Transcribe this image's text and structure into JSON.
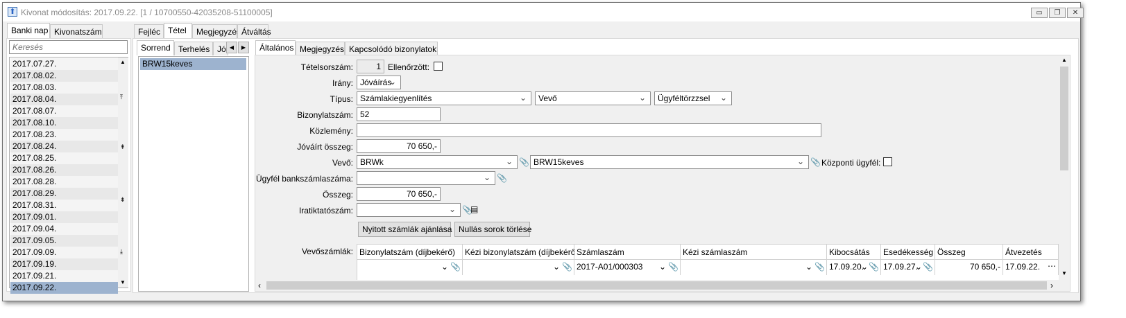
{
  "window": {
    "title": "Kivonat módosítás: 2017.09.22. [1 / 10700550-42035208-51100005]",
    "minimize": "▭",
    "restore": "❐",
    "close": "✕"
  },
  "left": {
    "tabs": [
      "Banki nap",
      "Kivonatszám"
    ],
    "search_placeholder": "Keresés",
    "dates": [
      "2017.07.27.",
      "2017.08.02.",
      "2017.08.03.",
      "2017.08.04.",
      "2017.08.07.",
      "2017.08.10.",
      "2017.08.23.",
      "2017.08.24.",
      "2017.08.25.",
      "2017.08.26.",
      "2017.08.28.",
      "2017.08.29.",
      "2017.08.31.",
      "2017.09.01.",
      "2017.09.04.",
      "2017.09.05.",
      "2017.09.09.",
      "2017.09.19.",
      "2017.09.21.",
      "2017.09.22."
    ],
    "selected": "2017.09.22."
  },
  "main_tabs": [
    "Fejléc",
    "Tétel",
    "Megjegyzés",
    "Átváltás"
  ],
  "middle": {
    "tabs": [
      "Sorrend",
      "Terhelés",
      "Jóv"
    ],
    "items": [
      "BRW15keves"
    ]
  },
  "right": {
    "tabs": [
      "Általános",
      "Megjegyzés",
      "Kapcsolódó bizonylatok"
    ],
    "form": {
      "tetelsorszam_label": "Tételsorszám:",
      "tetelsorszam": "1",
      "ellenorzott_label": "Ellenőrzött:",
      "irany_label": "Irány:",
      "irany": "Jóváírás",
      "tipus_label": "Típus:",
      "tipus": "Számlakiegyenlítés",
      "tipus2": "Vevő",
      "tipus3": "Ügyféltörzzsel",
      "bizonylatszam_label": "Bizonylatszám:",
      "bizonylatszam": "52",
      "kozlemeny_label": "Közlemény:",
      "kozlemeny": "",
      "jovairt_label": "Jóváírt összeg:",
      "jovairt": "70 650,-",
      "vevo_label": "Vevő:",
      "vevo": "BRWk",
      "vevo2": "BRW15keves",
      "kozponti_label": "Központi ügyfél:",
      "bankszamla_label": "Ügyfél bankszámlaszáma:",
      "bankszamla": "",
      "osszeg_label": "Összeg:",
      "osszeg": "70 650,-",
      "iktato_label": "Iratiktatószám:",
      "iktato": "",
      "btn_nyitott": "Nyitott számlák ajánlása",
      "btn_nullas": "Nullás sorok törlése"
    },
    "grid": {
      "label": "Vevőszámlák:",
      "headers": [
        "Bizonylatszám (díjbekérő)",
        "Kézi bizonylatszám (díjbekérő)",
        "Számlaszám",
        "Kézi számlaszám",
        "Kibocsátás",
        "Esedékesség",
        "Összeg",
        "Átvezetés"
      ],
      "row": [
        "",
        "",
        "2017-A01/000303",
        "",
        "17.09.20.",
        "17.09.27.",
        "70 650,-",
        "17.09.22."
      ]
    }
  }
}
